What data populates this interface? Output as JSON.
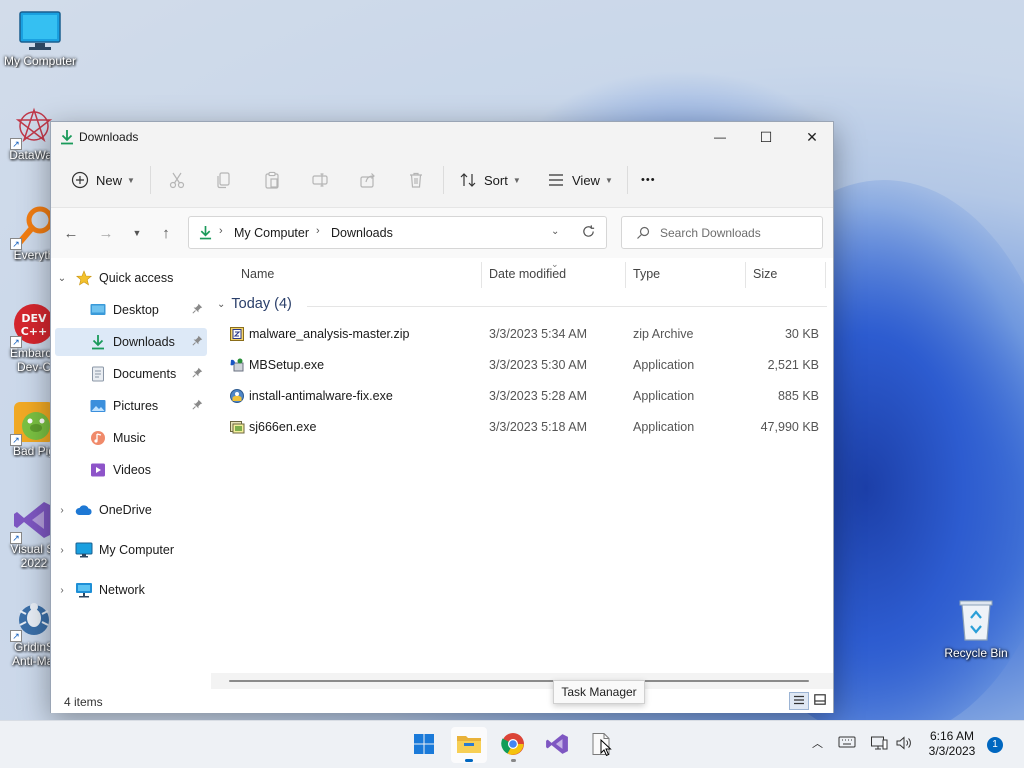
{
  "desktop": {
    "icons": [
      {
        "label": "My Computer",
        "icon": "monitor-icon"
      },
      {
        "label": "DataWag",
        "icon": "datawag-icon"
      },
      {
        "label": "Everyth",
        "icon": "everything-search-icon"
      },
      {
        "label": "Embarca",
        "label2": "Dev-C",
        "icon": "devcpp-icon"
      },
      {
        "label": "Bad Pig",
        "icon": "bad-piggies-icon"
      },
      {
        "label": "Visual St",
        "label2": "2022",
        "icon": "visual-studio-icon"
      },
      {
        "label": "GridinS",
        "label2": "Anti-Mal",
        "icon": "gridinsoft-icon"
      }
    ],
    "recycle_bin": {
      "label": "Recycle Bin",
      "icon": "recycle-bin-icon"
    }
  },
  "window": {
    "title": "Downloads",
    "controls": {
      "minimize": "—",
      "maximize": "☐",
      "close": "✕"
    }
  },
  "commandbar": {
    "new_label": "New",
    "sort_label": "Sort",
    "view_label": "View",
    "more_label": "•••",
    "disabled_icons": [
      "cut-icon",
      "copy-icon",
      "paste-icon",
      "rename-icon",
      "share-icon",
      "delete-icon"
    ]
  },
  "address": {
    "crumbs": [
      "My Computer",
      "Downloads"
    ],
    "search_placeholder": "Search Downloads"
  },
  "navpane": {
    "quick_access": "Quick access",
    "pinned": [
      {
        "label": "Desktop",
        "icon": "desktop-folder-icon",
        "pinned": true
      },
      {
        "label": "Downloads",
        "icon": "downloads-folder-icon",
        "pinned": true,
        "selected": true
      },
      {
        "label": "Documents",
        "icon": "documents-folder-icon",
        "pinned": true
      },
      {
        "label": "Pictures",
        "icon": "pictures-folder-icon",
        "pinned": true
      },
      {
        "label": "Music",
        "icon": "music-folder-icon",
        "pinned": false
      },
      {
        "label": "Videos",
        "icon": "videos-folder-icon",
        "pinned": false
      }
    ],
    "roots": [
      {
        "label": "OneDrive",
        "icon": "onedrive-icon"
      },
      {
        "label": "My Computer",
        "icon": "monitor-icon"
      },
      {
        "label": "Network",
        "icon": "network-icon"
      }
    ]
  },
  "filelist": {
    "columns": [
      "Name",
      "Date modified",
      "Type",
      "Size"
    ],
    "group_label": "Today (4)",
    "files": [
      {
        "name": "malware_analysis-master.zip",
        "date": "3/3/2023 5:34 AM",
        "type": "zip Archive",
        "size": "30 KB",
        "icon": "zip-archive-icon"
      },
      {
        "name": "MBSetup.exe",
        "date": "3/3/2023 5:30 AM",
        "type": "Application",
        "size": "2,521 KB",
        "icon": "malwarebytes-setup-icon"
      },
      {
        "name": "install-antimalware-fix.exe",
        "date": "3/3/2023 5:28 AM",
        "type": "Application",
        "size": "885 KB",
        "icon": "installer-icon"
      },
      {
        "name": "sj666en.exe",
        "date": "3/3/2023 5:18 AM",
        "type": "Application",
        "size": "47,990 KB",
        "icon": "application-icon"
      }
    ]
  },
  "status": {
    "item_count": "4 items"
  },
  "tooltip": "Task Manager",
  "taskbar": {
    "apps": [
      "start-icon",
      "file-explorer-icon",
      "chrome-icon",
      "visual-studio-icon",
      "task-manager-icon"
    ],
    "clock_time": "6:16 AM",
    "clock_date": "3/3/2023",
    "notification_count": "1"
  },
  "colors": {
    "accent": "#0067c0",
    "selection": "#dde9f7",
    "download_arrow": "#1a9a5a"
  }
}
